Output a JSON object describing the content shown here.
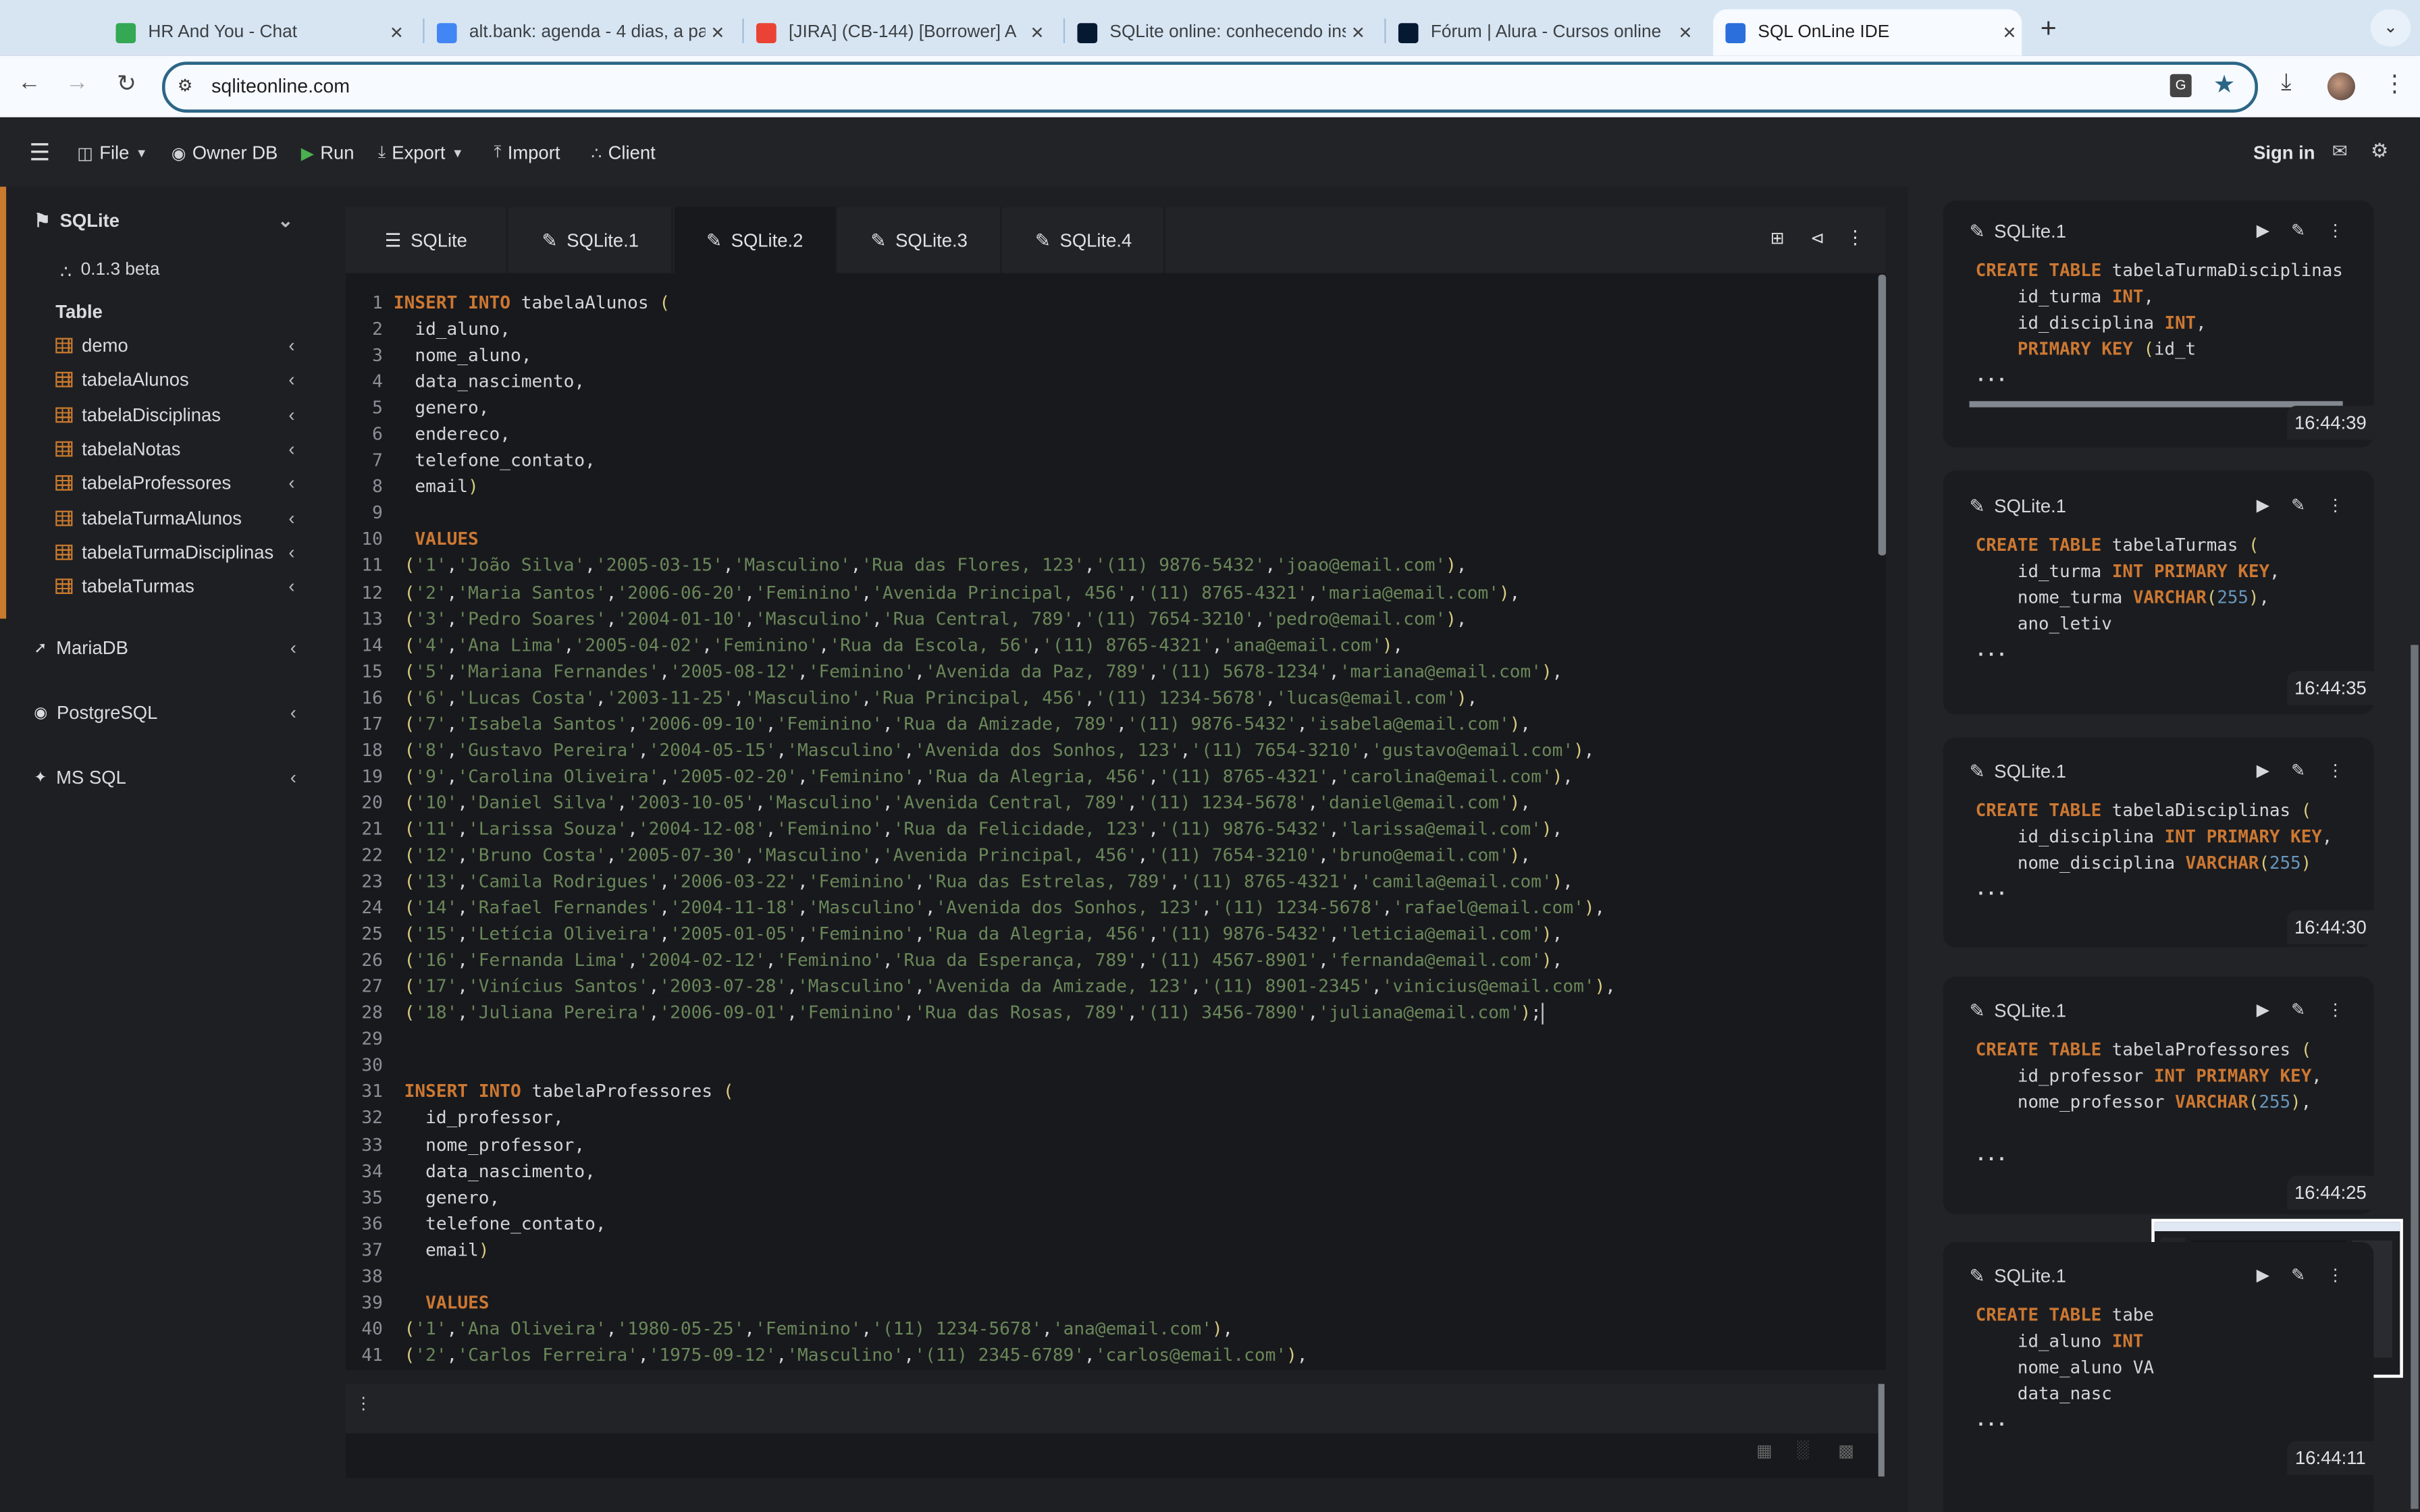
{
  "browser": {
    "tabs": [
      {
        "title": "HR And You - Chat",
        "icon": "google-chat-icon",
        "color": "#34a853"
      },
      {
        "title": "alt.bank: agenda - 4 dias, a pa",
        "icon": "google-calendar-icon",
        "color": "#4285f4"
      },
      {
        "title": "[JIRA] (CB-144) [Borrower] A",
        "icon": "gmail-icon",
        "color": "#ea4335"
      },
      {
        "title": "SQLite online: conhecendo ins",
        "icon": "alura-icon",
        "color": "#051933"
      },
      {
        "title": "Fórum | Alura - Cursos online",
        "icon": "alura-icon",
        "color": "#051933"
      },
      {
        "title": "SQL OnLine IDE",
        "icon": "sql-cloud-icon",
        "color": "#2a6fdb",
        "active": true
      }
    ],
    "url": "sqliteonline.com"
  },
  "appbar": {
    "menu": [
      {
        "label": "File",
        "icon": "database-icon",
        "dropdown": true
      },
      {
        "label": "Owner DB",
        "icon": "globe-icon"
      },
      {
        "label": "Run",
        "icon": "play-icon"
      },
      {
        "label": "Export",
        "icon": "download-icon",
        "dropdown": true
      },
      {
        "label": "Import",
        "icon": "upload-icon"
      },
      {
        "label": "Client",
        "icon": "network-icon"
      }
    ],
    "signin": "Sign in"
  },
  "sidebar": {
    "sqlite": {
      "label": "SQLite",
      "version": "0.1.3 beta",
      "section": "Table",
      "tables": [
        "demo",
        "tabelaAlunos",
        "tabelaDisciplinas",
        "tabelaNotas",
        "tabelaProfessores",
        "tabelaTurmaAlunos",
        "tabelaTurmaDisciplinas",
        "tabelaTurmas"
      ]
    },
    "others": [
      "MariaDB",
      "PostgreSQL",
      "MS SQL"
    ]
  },
  "editor": {
    "tabs": [
      "SQLite",
      "SQLite.1",
      "SQLite.2",
      "SQLite.3",
      "SQLite.4"
    ],
    "active_tab": "SQLite.2",
    "lines": [
      "INSERT INTO tabelaAlunos (",
      "  id_aluno,",
      "  nome_aluno,",
      "  data_nascimento,",
      "  genero,",
      "  endereco,",
      "  telefone_contato,",
      "  email)",
      "",
      "  VALUES",
      " ('1','João Silva','2005-03-15','Masculino','Rua das Flores, 123','(11) 9876-5432','joao@email.com'),",
      " ('2','Maria Santos','2006-06-20','Feminino','Avenida Principal, 456','(11) 8765-4321','maria@email.com'),",
      " ('3','Pedro Soares','2004-01-10','Masculino','Rua Central, 789','(11) 7654-3210','pedro@email.com'),",
      " ('4','Ana Lima','2005-04-02','Feminino','Rua da Escola, 56','(11) 8765-4321','ana@email.com'),",
      " ('5','Mariana Fernandes','2005-08-12','Feminino','Avenida da Paz, 789','(11) 5678-1234','mariana@email.com'),",
      " ('6','Lucas Costa','2003-11-25','Masculino','Rua Principal, 456','(11) 1234-5678','lucas@email.com'),",
      " ('7','Isabela Santos','2006-09-10','Feminino','Rua da Amizade, 789','(11) 9876-5432','isabela@email.com'),",
      " ('8','Gustavo Pereira','2004-05-15','Masculino','Avenida dos Sonhos, 123','(11) 7654-3210','gustavo@email.com'),",
      " ('9','Carolina Oliveira','2005-02-20','Feminino','Rua da Alegria, 456','(11) 8765-4321','carolina@email.com'),",
      " ('10','Daniel Silva','2003-10-05','Masculino','Avenida Central, 789','(11) 1234-5678','daniel@email.com'),",
      " ('11','Larissa Souza','2004-12-08','Feminino','Rua da Felicidade, 123','(11) 9876-5432','larissa@email.com'),",
      " ('12','Bruno Costa','2005-07-30','Masculino','Avenida Principal, 456','(11) 7654-3210','bruno@email.com'),",
      " ('13','Camila Rodrigues','2006-03-22','Feminino','Rua das Estrelas, 789','(11) 8765-4321','camila@email.com'),",
      " ('14','Rafael Fernandes','2004-11-18','Masculino','Avenida dos Sonhos, 123','(11) 1234-5678','rafael@email.com'),",
      " ('15','Letícia Oliveira','2005-01-05','Feminino','Rua da Alegria, 456','(11) 9876-5432','leticia@email.com'),",
      " ('16','Fernanda Lima','2004-02-12','Feminino','Rua da Esperança, 789','(11) 4567-8901','fernanda@email.com'),",
      " ('17','Vinícius Santos','2003-07-28','Masculino','Avenida da Amizade, 123','(11) 8901-2345','vinicius@email.com'),",
      " ('18','Juliana Pereira','2006-09-01','Feminino','Rua das Rosas, 789','(11) 3456-7890','juliana@email.com');",
      "",
      "",
      " INSERT INTO tabelaProfessores (",
      "   id_professor,",
      "   nome_professor,",
      "   data_nascimento,",
      "   genero,",
      "   telefone_contato,",
      "   email)",
      "",
      "   VALUES",
      " ('1','Ana Oliveira','1980-05-25','Feminino','(11) 1234-5678','ana@email.com'),",
      " ('2','Carlos Ferreira','1975-09-12','Masculino','(11) 2345-6789','carlos@email.com'),"
    ],
    "cursor_line": 28
  },
  "history": [
    {
      "db": "SQLite.1",
      "time": "16:44:39",
      "lines": [
        "CREATE TABLE tabelaTurmaDisciplinas",
        "    id_turma INT,",
        "    id_disciplina INT,",
        "    PRIMARY KEY (id_t"
      ],
      "more": "..."
    },
    {
      "db": "SQLite.1",
      "time": "16:44:35",
      "lines": [
        "CREATE TABLE tabelaTurmas (",
        "    id_turma INT PRIMARY KEY,",
        "    nome_turma VARCHAR(255),",
        "    ano_letiv"
      ],
      "more": "..."
    },
    {
      "db": "SQLite.1",
      "time": "16:44:30",
      "lines": [
        "CREATE TABLE tabelaDisciplinas (",
        "    id_disciplina INT PRIMARY KEY,",
        "    nome_disciplina VARCHAR(255)"
      ],
      "more": "..."
    },
    {
      "db": "SQLite.1",
      "time": "16:44:25",
      "lines": [
        "CREATE TABLE tabelaProfessores (",
        "    id_professor INT PRIMARY KEY,",
        "    nome_professor VARCHAR(255),",
        ""
      ],
      "more": "..."
    },
    {
      "db": "SQLite.1",
      "time": "16:44:11",
      "lines": [
        "CREATE TABLE tabe",
        "    id_aluno INT",
        "    nome_aluno VA",
        "    data_nasc"
      ],
      "more": "..."
    }
  ],
  "colors": {
    "accent": "#c87a2e",
    "keyword": "#cc7832",
    "string": "#6a8759",
    "number": "#6897bb",
    "omnibox_border": "#2c6686"
  }
}
